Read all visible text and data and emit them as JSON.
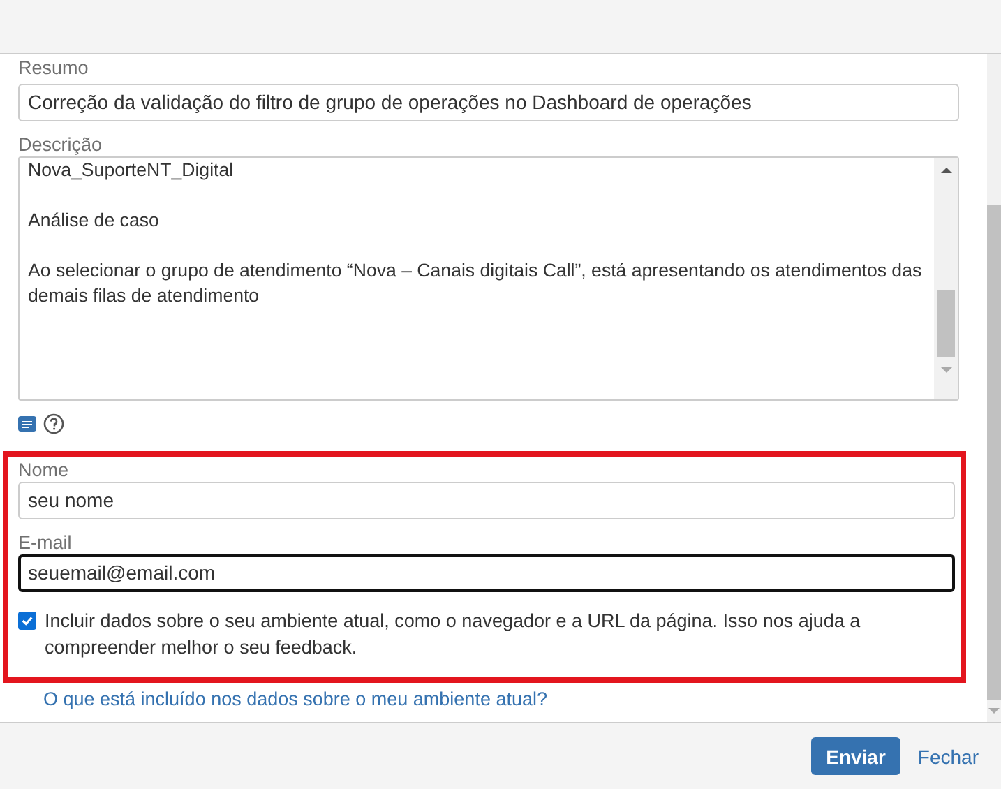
{
  "summary": {
    "label": "Resumo",
    "value": "Correção da validação do filtro de grupo de operações no Dashboard de operações"
  },
  "description": {
    "label": "Descrição",
    "paragraphs": [
      "Nova_SuporteNT_Digital",
      "Análise de caso",
      "Ao selecionar o grupo de atendimento “Nova – Canais digitais Call”, está apresentando os atendimentos das demais filas de atendimento"
    ]
  },
  "name": {
    "label": "Nome",
    "value": "seu nome"
  },
  "email": {
    "label": "E-mail",
    "value": "seuemail@email.com",
    "focused": true
  },
  "include_env": {
    "checked": true,
    "label": "Incluir dados sobre o seu ambiente atual, como o navegador e a URL da página. Isso nos ajuda a compreender melhor o seu feedback."
  },
  "env_link": "O que está incluído nos dados sobre o meu ambiente atual?",
  "buttons": {
    "submit": "Enviar",
    "close": "Fechar"
  }
}
